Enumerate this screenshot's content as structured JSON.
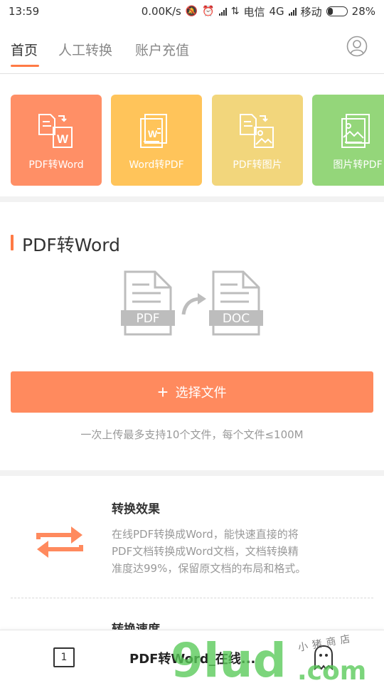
{
  "status_bar": {
    "time": "13:59",
    "speed": "0.00K/s",
    "carrier1": "电信",
    "network": "4G",
    "carrier2": "移动",
    "battery": "28%",
    "battery_level": 0.28
  },
  "nav": {
    "tabs": [
      {
        "label": "首页"
      },
      {
        "label": "人工转换"
      },
      {
        "label": "账户充值"
      }
    ]
  },
  "tools": [
    {
      "label": "PDF转Word",
      "color": "#ff8f66"
    },
    {
      "label": "Word转PDF",
      "color": "#ffc45a"
    },
    {
      "label": "PDF转图片",
      "color": "#f2d67c"
    },
    {
      "label": "图片转PDF",
      "color": "#94d67a"
    }
  ],
  "section": {
    "title": "PDF转Word",
    "from_label": "PDF",
    "to_label": "DOC",
    "select_label": "选择文件",
    "hint": "一次上传最多支持10个文件，每个文件≤100M"
  },
  "features": [
    {
      "title": "转换效果",
      "lines": [
        "在线PDF转换成Word，能快速直接的将",
        "PDF文档转换成Word文档，文档转换精",
        "准度达99%，保留原文档的布局和格式。"
      ]
    },
    {
      "title": "转换速度"
    }
  ],
  "bottom_bar": {
    "tab_count": "1",
    "page_title": "PDF转Word_在线..."
  },
  "watermark": {
    "text": "9lud",
    "domain": ".com",
    "shop": "小猪商店"
  },
  "colors": {
    "accent": "#ff7a45",
    "button": "#ff8a5e"
  }
}
